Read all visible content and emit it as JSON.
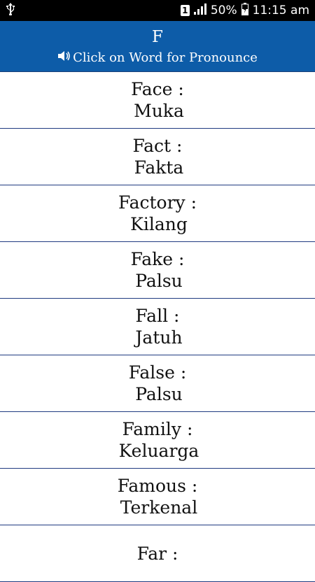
{
  "status_bar": {
    "usb_icon": "usb-icon",
    "sim_label": "1",
    "battery_percent": "50%",
    "time": "11:15 am"
  },
  "header": {
    "title": "F",
    "subtitle": "Click on Word for Pronounce",
    "speaker_icon": "speaker-icon"
  },
  "words": [
    {
      "word": "Face :",
      "meaning": "Muka"
    },
    {
      "word": "Fact :",
      "meaning": "Fakta"
    },
    {
      "word": "Factory :",
      "meaning": "Kilang"
    },
    {
      "word": "Fake :",
      "meaning": "Palsu"
    },
    {
      "word": "Fall :",
      "meaning": "Jatuh"
    },
    {
      "word": "False :",
      "meaning": "Palsu"
    },
    {
      "word": "Family :",
      "meaning": "Keluarga"
    },
    {
      "word": "Famous :",
      "meaning": "Terkenal"
    },
    {
      "word": "Far :",
      "meaning": ""
    }
  ]
}
